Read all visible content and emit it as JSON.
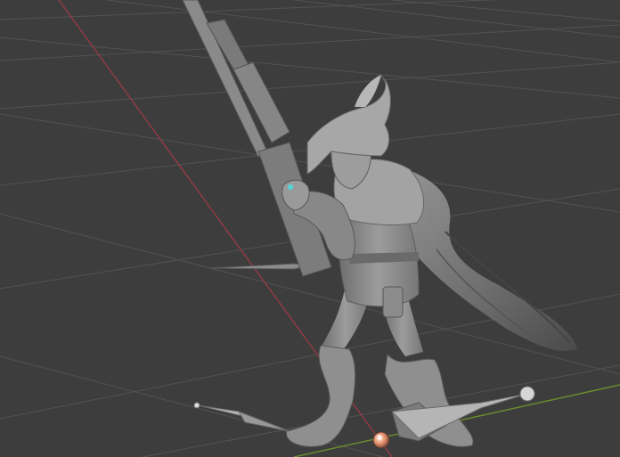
{
  "viewport": {
    "background": "#3d3d3d",
    "grid_color": "#525252",
    "x_axis_color": "#9a3b45",
    "y_axis_color": "#6a8c2c",
    "model_color": "#8a8a8a",
    "model_shadow": "#5e5e5e",
    "model_highlight": "#b4b4b4"
  },
  "icons": {
    "origin": "origin-gizmo-icon",
    "bone_tip": "bone-end-sphere-icon",
    "eye_glow": "eye-glow-icon"
  }
}
